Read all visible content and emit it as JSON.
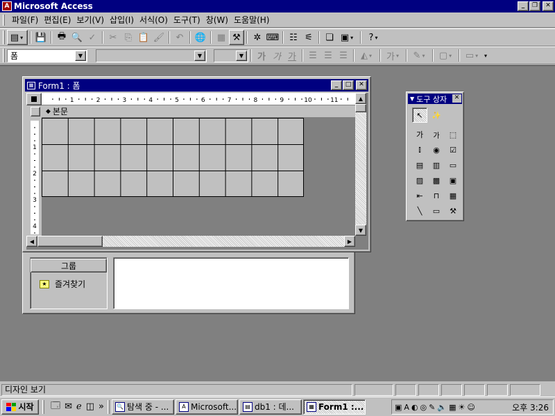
{
  "window": {
    "title": "Microsoft Access",
    "icon": "access-key-icon"
  },
  "menu": [
    "파일(F)",
    "편집(E)",
    "보기(V)",
    "삽입(I)",
    "서식(O)",
    "도구(T)",
    "창(W)",
    "도움말(H)"
  ],
  "format_toolbar": {
    "object_combo": "폼",
    "font_combo": "",
    "size_combo": ""
  },
  "form_window": {
    "title": "Form1 : 폼",
    "section_label": "본문",
    "ruler_h": [
      "1",
      "2",
      "3",
      "4",
      "5",
      "6",
      "7",
      "8",
      "9",
      "10",
      "11"
    ],
    "ruler_v": [
      "1",
      "2",
      "3",
      "4"
    ]
  },
  "toolbox": {
    "title": "도구 상자"
  },
  "db_window": {
    "groups_label": "그룹",
    "favorites_label": "즐겨찾기"
  },
  "status": {
    "text": "디자인 보기"
  },
  "taskbar": {
    "start_label": "시작",
    "tasks": [
      "탐색 중 - ...",
      "Microsoft...",
      "db1 : 데...",
      "Form1 :..."
    ],
    "clock": "오후 3:26"
  },
  "colors": {
    "title_active": "#000080",
    "face": "#c0c0c0",
    "workspace": "#808080"
  }
}
